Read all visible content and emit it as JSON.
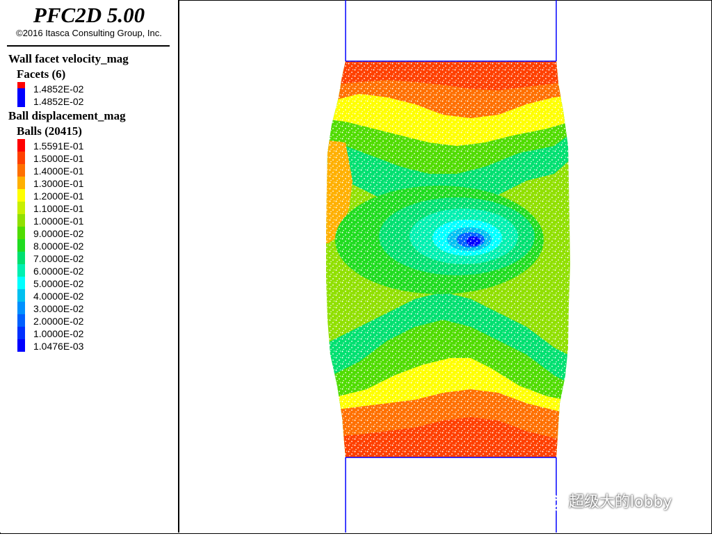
{
  "app": {
    "title": "PFC2D 5.00",
    "copyright": "©2016 Itasca Consulting Group, Inc."
  },
  "legend": {
    "wall_heading": "Wall facet velocity_mag",
    "wall_sub": "Facets (6)",
    "wall_entries": [
      {
        "label": "1.4852E-02",
        "color": "#ff0000"
      },
      {
        "label": "1.4852E-02",
        "color": "#0000ff"
      }
    ],
    "ball_heading": "Ball displacement_mag",
    "ball_sub": "Balls (20415)",
    "ball_entries": [
      {
        "label": "1.5591E-01",
        "color": "#ff0000"
      },
      {
        "label": "1.5000E-01",
        "color": "#ff4000"
      },
      {
        "label": "1.4000E-01",
        "color": "#ff7000"
      },
      {
        "label": "1.3000E-01",
        "color": "#ffb000"
      },
      {
        "label": "1.2000E-01",
        "color": "#ffff00"
      },
      {
        "label": "1.1000E-01",
        "color": "#c8f000"
      },
      {
        "label": "1.0000E-01",
        "color": "#90e000"
      },
      {
        "label": "9.0000E-02",
        "color": "#50dc00"
      },
      {
        "label": "8.0000E-02",
        "color": "#20dc20"
      },
      {
        "label": "7.0000E-02",
        "color": "#00e070"
      },
      {
        "label": "6.0000E-02",
        "color": "#00f0b0"
      },
      {
        "label": "5.0000E-02",
        "color": "#00ffff"
      },
      {
        "label": "4.0000E-02",
        "color": "#00c0f0"
      },
      {
        "label": "3.0000E-02",
        "color": "#0090ff"
      },
      {
        "label": "2.0000E-02",
        "color": "#0060ff"
      },
      {
        "label": "1.0000E-02",
        "color": "#0030ff"
      },
      {
        "label": "1.0476E-03",
        "color": "#0000ff"
      }
    ]
  },
  "watermark": {
    "text": "超级大的lobby",
    "icon": "wechat-icon"
  }
}
